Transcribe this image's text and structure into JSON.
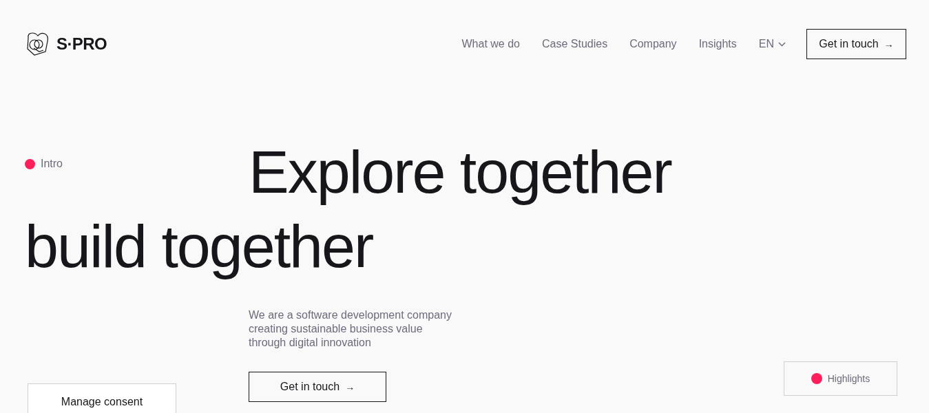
{
  "logo": {
    "text": "S·PRO"
  },
  "nav": [
    {
      "label": "What we do"
    },
    {
      "label": "Case Studies"
    },
    {
      "label": "Company"
    },
    {
      "label": "Insights"
    }
  ],
  "language": {
    "label": "EN"
  },
  "header_button": {
    "label": "Get in touch",
    "arrow": "→"
  },
  "intro_label": {
    "text": "Intro",
    "color": "#ff1f5a"
  },
  "headline": [
    "Explore together",
    "build together"
  ],
  "description": "We are a software development company creating sustainable business value through digital innovation",
  "cta_button": {
    "label": "Get in touch",
    "arrow": "→"
  },
  "consent_button": {
    "label": "Manage consent"
  },
  "highlights_button": {
    "label": "Highlights",
    "color": "#ff1f5a"
  }
}
